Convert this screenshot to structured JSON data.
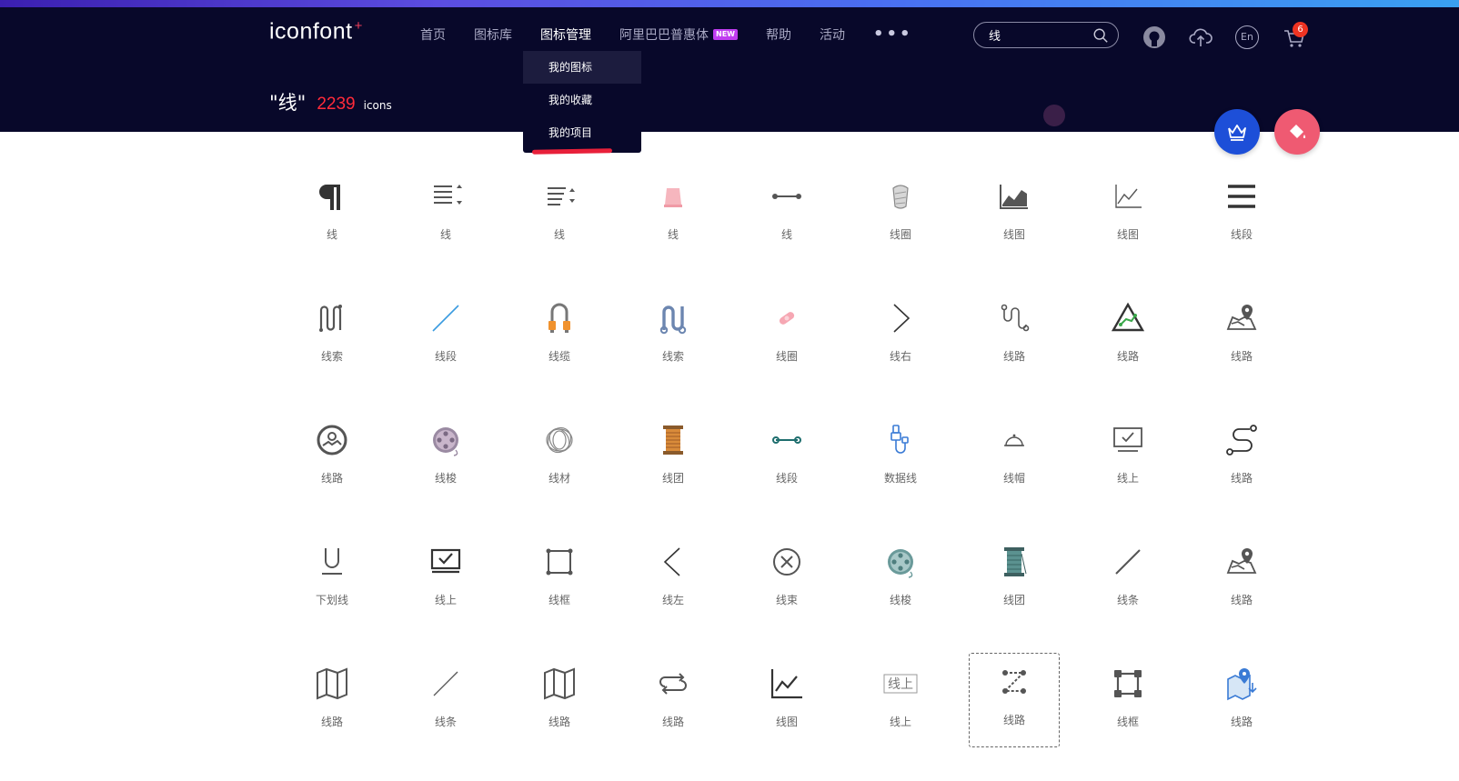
{
  "header": {
    "logo": "iconfont",
    "logo_plus": "+",
    "nav": [
      "首页",
      "图标库",
      "图标管理",
      "阿里巴巴普惠体",
      "帮助",
      "活动"
    ],
    "nav_badge": "NEW",
    "nav_more": "•••",
    "search_value": "线",
    "cart_count": "6",
    "lang_label": "En"
  },
  "dropdown": {
    "items": [
      "我的图标",
      "我的收藏",
      "我的项目"
    ]
  },
  "result": {
    "query": "\"线\"",
    "count": "2239",
    "unit": "icons"
  },
  "colors": {
    "header_bg": "#08082a",
    "accent_red": "#ff2b3a",
    "crown_button": "#1d4fd8",
    "paint_button": "#ef5a72"
  },
  "icons": [
    {
      "label": "线",
      "icon": "pilcrow-icon"
    },
    {
      "label": "线",
      "icon": "sort-lines-icon"
    },
    {
      "label": "线",
      "icon": "sort-lines-small-icon"
    },
    {
      "label": "线",
      "icon": "pink-spool-icon"
    },
    {
      "label": "线",
      "icon": "dot-line-icon"
    },
    {
      "label": "线圈",
      "icon": "yarn-coil-icon"
    },
    {
      "label": "线图",
      "icon": "area-chart-icon"
    },
    {
      "label": "线图",
      "icon": "line-chart-icon"
    },
    {
      "label": "线段",
      "icon": "hamburger-lines-icon"
    },
    {
      "label": "线索",
      "icon": "rope-loops-icon"
    },
    {
      "label": "线段",
      "icon": "diagonal-blue-line-icon"
    },
    {
      "label": "线缆",
      "icon": "cable-icon"
    },
    {
      "label": "线索",
      "icon": "blue-rope-icon"
    },
    {
      "label": "线圈",
      "icon": "pink-bandage-icon"
    },
    {
      "label": "线右",
      "icon": "chevron-right-icon"
    },
    {
      "label": "线路",
      "icon": "route-curve-icon"
    },
    {
      "label": "线路",
      "icon": "triangle-route-icon"
    },
    {
      "label": "线路",
      "icon": "map-pin-icon"
    },
    {
      "label": "线路",
      "icon": "circle-map-icon"
    },
    {
      "label": "线梭",
      "icon": "film-reel-icon"
    },
    {
      "label": "线材",
      "icon": "wire-coil-icon"
    },
    {
      "label": "线团",
      "icon": "thread-spool-icon"
    },
    {
      "label": "线段",
      "icon": "teal-segment-icon"
    },
    {
      "label": "数据线",
      "icon": "usb-cable-icon"
    },
    {
      "label": "线帽",
      "icon": "bell-cap-icon"
    },
    {
      "label": "线上",
      "icon": "monitor-check-icon"
    },
    {
      "label": "线路",
      "icon": "s-route-icon"
    },
    {
      "label": "下划线",
      "icon": "underline-icon"
    },
    {
      "label": "线上",
      "icon": "monitor-check-bold-icon"
    },
    {
      "label": "线框",
      "icon": "square-frame-icon"
    },
    {
      "label": "线左",
      "icon": "chevron-left-icon"
    },
    {
      "label": "线束",
      "icon": "circle-x-icon"
    },
    {
      "label": "线梭",
      "icon": "teal-reel-icon"
    },
    {
      "label": "线团",
      "icon": "teal-spool-icon"
    },
    {
      "label": "线条",
      "icon": "slash-line-icon"
    },
    {
      "label": "线路",
      "icon": "map-pin-2-icon"
    },
    {
      "label": "线路",
      "icon": "folded-map-icon"
    },
    {
      "label": "线条",
      "icon": "thin-slash-icon"
    },
    {
      "label": "线路",
      "icon": "folded-map-2-icon"
    },
    {
      "label": "线路",
      "icon": "swap-arrows-icon"
    },
    {
      "label": "线图",
      "icon": "axis-line-chart-icon"
    },
    {
      "label": "线上",
      "icon": "online-text-icon"
    },
    {
      "label": "线路",
      "icon": "z-route-icon"
    },
    {
      "label": "线框",
      "icon": "node-frame-icon"
    },
    {
      "label": "线路",
      "icon": "map-location-icon"
    }
  ]
}
